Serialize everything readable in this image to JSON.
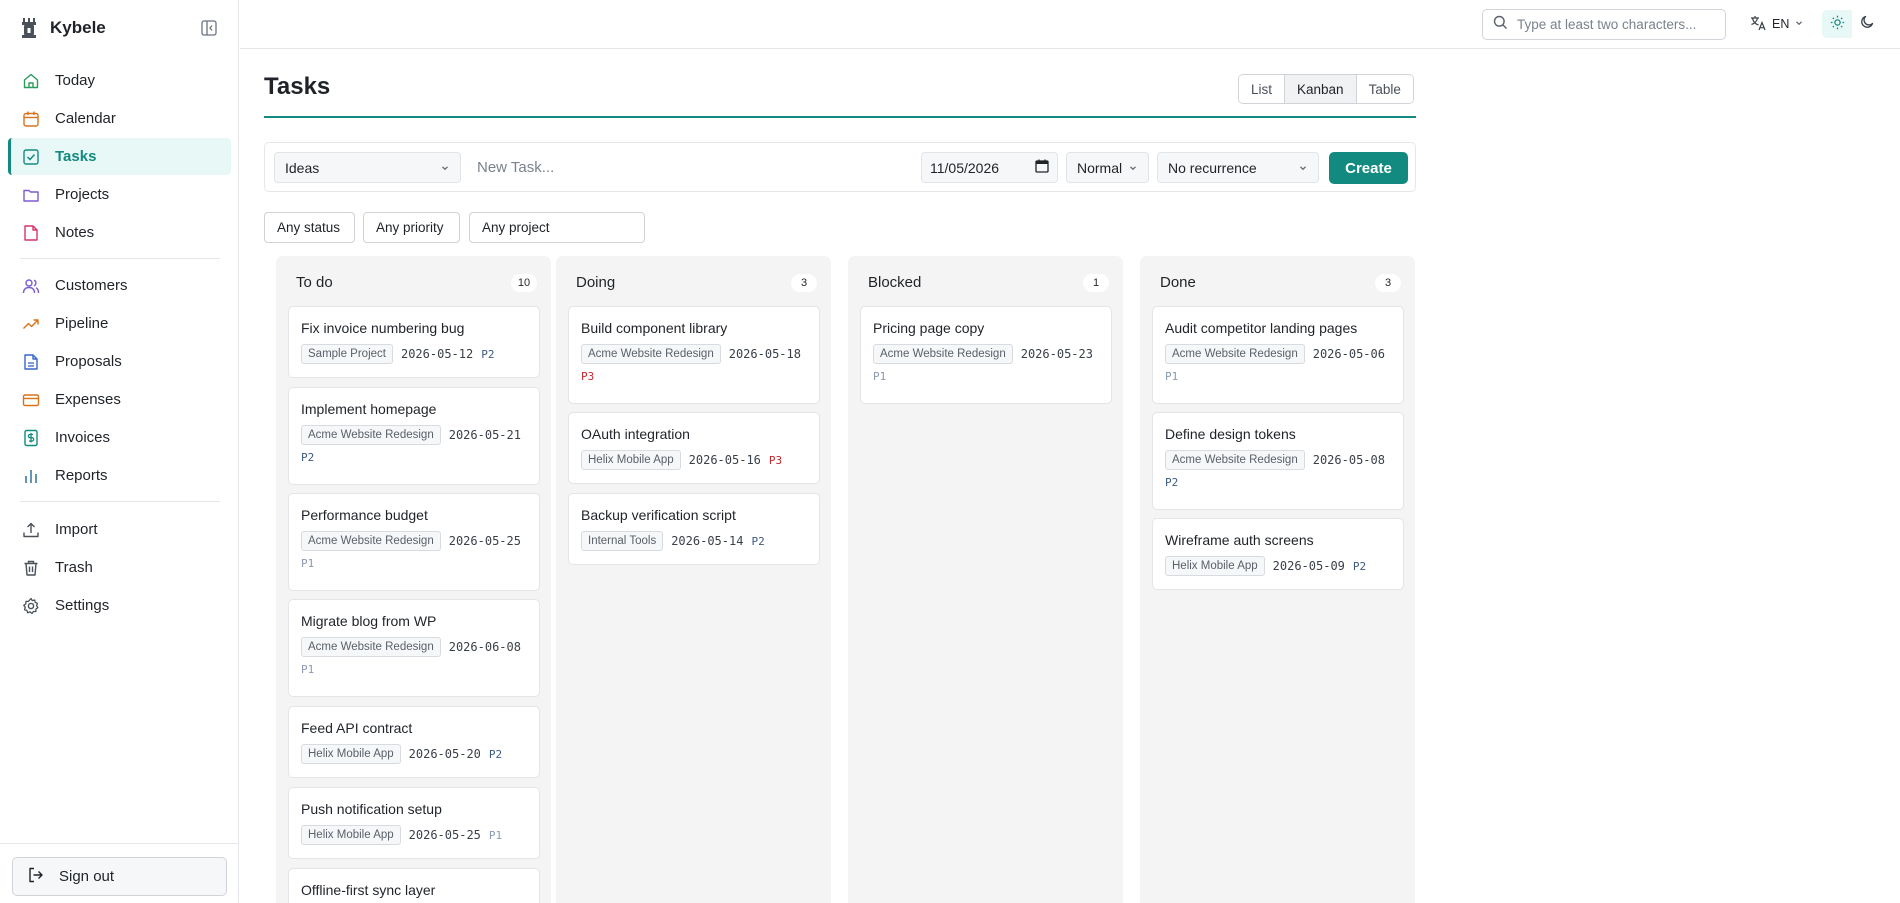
{
  "app": {
    "name": "Kybele"
  },
  "sidebar": {
    "items": [
      {
        "key": "today",
        "label": "Today"
      },
      {
        "key": "calendar",
        "label": "Calendar"
      },
      {
        "key": "tasks",
        "label": "Tasks"
      },
      {
        "key": "projects",
        "label": "Projects"
      },
      {
        "key": "notes",
        "label": "Notes"
      },
      {
        "key": "customers",
        "label": "Customers"
      },
      {
        "key": "pipeline",
        "label": "Pipeline"
      },
      {
        "key": "proposals",
        "label": "Proposals"
      },
      {
        "key": "expenses",
        "label": "Expenses"
      },
      {
        "key": "invoices",
        "label": "Invoices"
      },
      {
        "key": "reports",
        "label": "Reports"
      },
      {
        "key": "import",
        "label": "Import"
      },
      {
        "key": "trash",
        "label": "Trash"
      },
      {
        "key": "settings",
        "label": "Settings"
      }
    ],
    "active": "tasks",
    "signout_label": "Sign out"
  },
  "topbar": {
    "search_placeholder": "Type at least two characters...",
    "language": "EN"
  },
  "page": {
    "title": "Tasks",
    "views": [
      "List",
      "Kanban",
      "Table"
    ],
    "active_view": "Kanban"
  },
  "new_task": {
    "project": "Ideas",
    "placeholder": "New Task...",
    "due_date": "11/05/2026",
    "priority": "Normal",
    "recurrence": "No recurrence",
    "create_label": "Create"
  },
  "filters": {
    "status": "Any status",
    "priority": "Any priority",
    "project": "Any project"
  },
  "board": {
    "columns": [
      {
        "title": "To do",
        "count": "10",
        "cards": [
          {
            "title": "Fix invoice numbering bug",
            "project": "Sample Project",
            "date": "2026-05-12",
            "priority": "P2"
          },
          {
            "title": "Implement homepage",
            "project": "Acme Website Redesign",
            "date": "2026-05-21",
            "priority": "P2"
          },
          {
            "title": "Performance budget",
            "project": "Acme Website Redesign",
            "date": "2026-05-25",
            "priority": "P1"
          },
          {
            "title": "Migrate blog from WP",
            "project": "Acme Website Redesign",
            "date": "2026-06-08",
            "priority": "P1"
          },
          {
            "title": "Feed API contract",
            "project": "Helix Mobile App",
            "date": "2026-05-20",
            "priority": "P2"
          },
          {
            "title": "Push notification setup",
            "project": "Helix Mobile App",
            "date": "2026-05-25",
            "priority": "P1"
          },
          {
            "title": "Offline-first sync layer",
            "project": "",
            "date": "",
            "priority": ""
          }
        ]
      },
      {
        "title": "Doing",
        "count": "3",
        "cards": [
          {
            "title": "Build component library",
            "project": "Acme Website Redesign",
            "date": "2026-05-18",
            "priority": "P3"
          },
          {
            "title": "OAuth integration",
            "project": "Helix Mobile App",
            "date": "2026-05-16",
            "priority": "P3"
          },
          {
            "title": "Backup verification script",
            "project": "Internal Tools",
            "date": "2026-05-14",
            "priority": "P2"
          }
        ]
      },
      {
        "title": "Blocked",
        "count": "1",
        "cards": [
          {
            "title": "Pricing page copy",
            "project": "Acme Website Redesign",
            "date": "2026-05-23",
            "priority": "P1"
          }
        ]
      },
      {
        "title": "Done",
        "count": "3",
        "cards": [
          {
            "title": "Audit competitor landing pages",
            "project": "Acme Website Redesign",
            "date": "2026-05-06",
            "priority": "P1"
          },
          {
            "title": "Define design tokens",
            "project": "Acme Website Redesign",
            "date": "2026-05-08",
            "priority": "P2"
          },
          {
            "title": "Wireframe auth screens",
            "project": "Helix Mobile App",
            "date": "2026-05-09",
            "priority": "P2"
          }
        ]
      }
    ]
  },
  "colors": {
    "accent": "#138a80",
    "priority_p1": "#8a9ab0",
    "priority_p2": "#3d5a80",
    "priority_p3": "#c0282d"
  }
}
